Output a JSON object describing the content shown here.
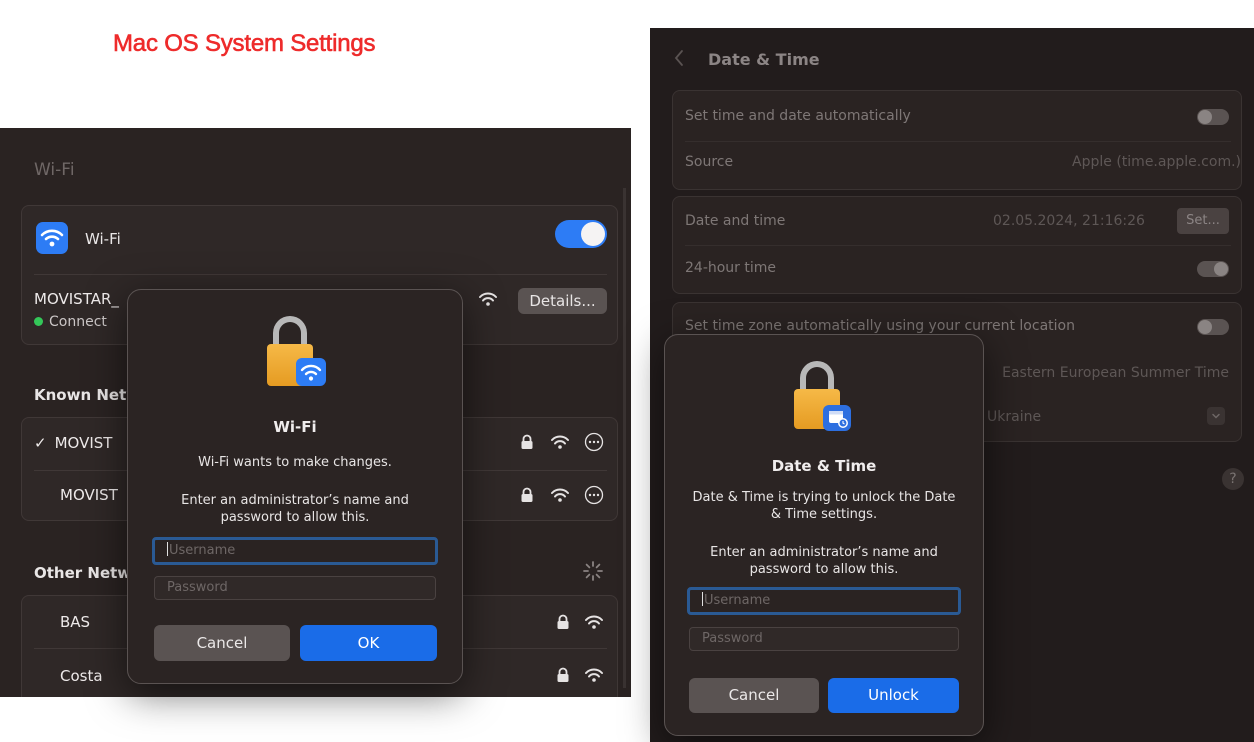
{
  "page_title": "Mac OS System Settings",
  "left": {
    "header": "Wi-Fi",
    "wifi_label": "Wi-Fi",
    "current_network": "MOVISTAR_",
    "current_status": "Connect",
    "details_button": "Details...",
    "known_header": "Known Netw",
    "known_networks": [
      {
        "check": "✓",
        "name": "MOVIST"
      },
      {
        "check": "",
        "name": "MOVIST"
      }
    ],
    "other_header": "Other Netw",
    "other_networks": [
      {
        "name": "BAS"
      },
      {
        "name": "Costa"
      }
    ],
    "dialog": {
      "title": "Wi-Fi",
      "message": "Wi-Fi wants to make changes.",
      "instruction_line1": "Enter an administrator’s name and",
      "instruction_line2": "password to allow this.",
      "username_placeholder": "Username",
      "password_placeholder": "Password",
      "cancel": "Cancel",
      "ok": "OK"
    }
  },
  "right": {
    "title": "Date & Time",
    "auto_time_label": "Set time and date automatically",
    "source_label": "Source",
    "source_value": "Apple (time.apple.com.)",
    "date_time_label": "Date and time",
    "date_time_value": "02.05.2024, 21:16:26",
    "set_button": "Set...",
    "hour24_label": "24-hour time",
    "tz_auto_label": "Set time zone automatically using your current location",
    "tz_value": "Eastern European Summer Time",
    "city_value": "Ukraine",
    "help": "?",
    "dialog": {
      "title": "Date & Time",
      "message_line1": "Date & Time is trying to unlock the Date",
      "message_line2": "& Time settings.",
      "instruction_line1": "Enter an administrator’s name and",
      "instruction_line2": "password to allow this.",
      "username_placeholder": "Username",
      "password_placeholder": "Password",
      "cancel": "Cancel",
      "unlock": "Unlock"
    }
  },
  "colors": {
    "accent_blue": "#2d7cf5",
    "title_red": "#ee2b2b",
    "connected_green": "#34c759"
  }
}
